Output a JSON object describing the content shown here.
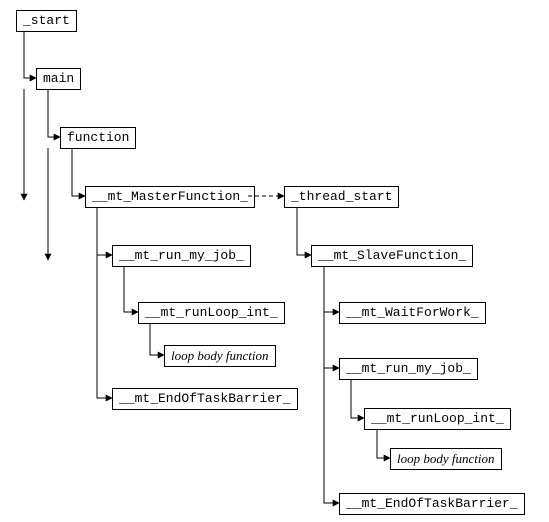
{
  "nodes": {
    "start": {
      "label": "_start"
    },
    "main": {
      "label": "main"
    },
    "function": {
      "label": "function"
    },
    "master": {
      "label": "__mt_MasterFunction_"
    },
    "thread_start": {
      "label": "_thread_start"
    },
    "run_job_l": {
      "label": "__mt_run_my_job_"
    },
    "runloop_l": {
      "label": "__mt_runLoop_int_"
    },
    "loopbody_l": {
      "label": "loop body function"
    },
    "end_barrier_l": {
      "label": "__mt_EndOfTaskBarrier_"
    },
    "slave": {
      "label": "__mt_SlaveFunction_"
    },
    "wait": {
      "label": "__mt_WaitForWork_"
    },
    "run_job_r": {
      "label": "__mt_run_my_job_"
    },
    "runloop_r": {
      "label": "__mt_runLoop_int_"
    },
    "loopbody_r": {
      "label": "loop body function"
    },
    "end_barrier_r": {
      "label": "__mt_EndOfTaskBarrier_"
    }
  }
}
